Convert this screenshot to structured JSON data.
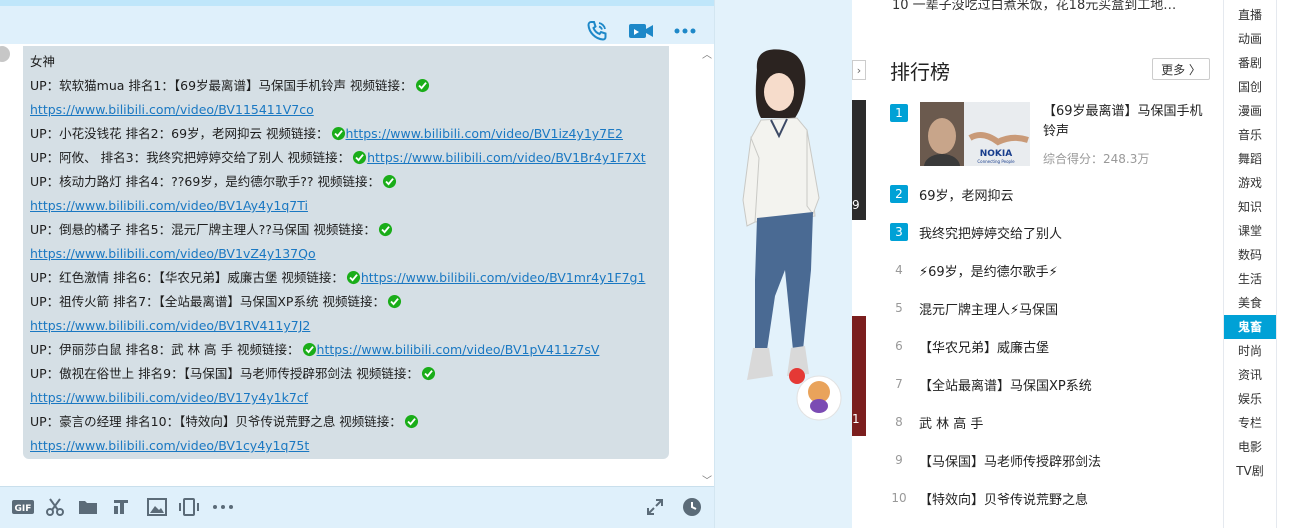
{
  "chat": {
    "sender_name": "女神",
    "messages": [
      {
        "text": "UP：软软猫mua 排名1：【69岁最离谱】马保国手机铃声 视频链接：",
        "link": "https://www.bilibili.com/video/BV115411V7co"
      },
      {
        "text": "UP：小花没钱花 排名2：69岁，老网抑云 视频链接：",
        "link": "https://www.bilibili.com/video/BV1iz4y1y7E2"
      },
      {
        "text": "UP：阿攸、 排名3：我终究把婷婷交给了别人 视频链接：",
        "link": "https://www.bilibili.com/video/BV1Br4y1F7Xt"
      },
      {
        "text": "UP：核动力路灯 排名4：??69岁，是约德尔歌手?? 视频链接：",
        "link": "https://www.bilibili.com/video/BV1Ay4y1q7Ti"
      },
      {
        "text": "UP：倒悬的橘子 排名5：混元厂牌主理人??马保国 视频链接：",
        "link": "https://www.bilibili.com/video/BV1vZ4y137Qo"
      },
      {
        "text": "UP：红色激情 排名6：【华农兄弟】威廉古堡 视频链接：",
        "link": "https://www.bilibili.com/video/BV1mr4y1F7g1"
      },
      {
        "text": "UP：祖传火箭 排名7：【全站最离谱】马保国XP系统 视频链接：",
        "link": "https://www.bilibili.com/video/BV1RV411y7J2"
      },
      {
        "text": "UP：伊丽莎白鼠 排名8：武 林 高 手 视频链接：",
        "link": "https://www.bilibili.com/video/BV1pV411z7sV"
      },
      {
        "text": "UP：傲视在俗世上 排名9：【马保国】马老师传授辟邪剑法 视频链接：",
        "link": "https://www.bilibili.com/video/BV17y4y1k7cf"
      },
      {
        "text": "UP：豪言の经理 排名10：【特效向】贝爷传说荒野之息 视频链接：",
        "link": "https://www.bilibili.com/video/BV1cy4y1q75t"
      }
    ],
    "header_icons": [
      "phone-icon",
      "video-camera-icon",
      "more-icon"
    ],
    "toolbar_icons": [
      "gif-icon",
      "scissors-icon",
      "folder-icon",
      "music-icon",
      "image-icon",
      "shake-icon",
      "more-icon",
      "expand-icon",
      "history-icon"
    ],
    "toolbar_gif_label": "GIF",
    "colors": {
      "link": "#1a78c2",
      "check": "#1aad19",
      "bubble": "#d5dfe5"
    }
  },
  "rank": {
    "top_partial_text": "10  一辈子没吃过白煮米饭，花18元买盒到工地…",
    "title": "排行榜",
    "more_label": "更多 〉",
    "first": {
      "num": "1",
      "title": "【69岁最离谱】马保国手机铃声",
      "score": "综合得分：248.3万",
      "thumb_brand": "NOKIA",
      "thumb_tagline": "Connecting People"
    },
    "items": [
      {
        "num": "2",
        "title": "69岁，老网抑云",
        "top": true
      },
      {
        "num": "3",
        "title": "我终究把婷婷交给了别人",
        "top": true
      },
      {
        "num": "4",
        "title": "⚡69岁，是约德尔歌手⚡",
        "top": false
      },
      {
        "num": "5",
        "title": "混元厂牌主理人⚡马保国",
        "top": false
      },
      {
        "num": "6",
        "title": "【华农兄弟】威廉古堡",
        "top": false
      },
      {
        "num": "7",
        "title": "【全站最离谱】马保国XP系统",
        "top": false
      },
      {
        "num": "8",
        "title": "武 林 高 手",
        "top": false
      },
      {
        "num": "9",
        "title": "【马保国】马老师传授辟邪剑法",
        "top": false
      },
      {
        "num": "10",
        "title": "【特效向】贝爷传说荒野之息",
        "top": false
      }
    ],
    "left_strip_labels": [
      "9",
      "1"
    ],
    "accent": "#00a1d6"
  },
  "categories": [
    "直播",
    "动画",
    "番剧",
    "国创",
    "漫画",
    "音乐",
    "舞蹈",
    "游戏",
    "知识",
    "课堂",
    "数码",
    "生活",
    "美食",
    "鬼畜",
    "时尚",
    "资讯",
    "娱乐",
    "专栏",
    "电影",
    "TV剧"
  ],
  "active_category": "鬼畜"
}
